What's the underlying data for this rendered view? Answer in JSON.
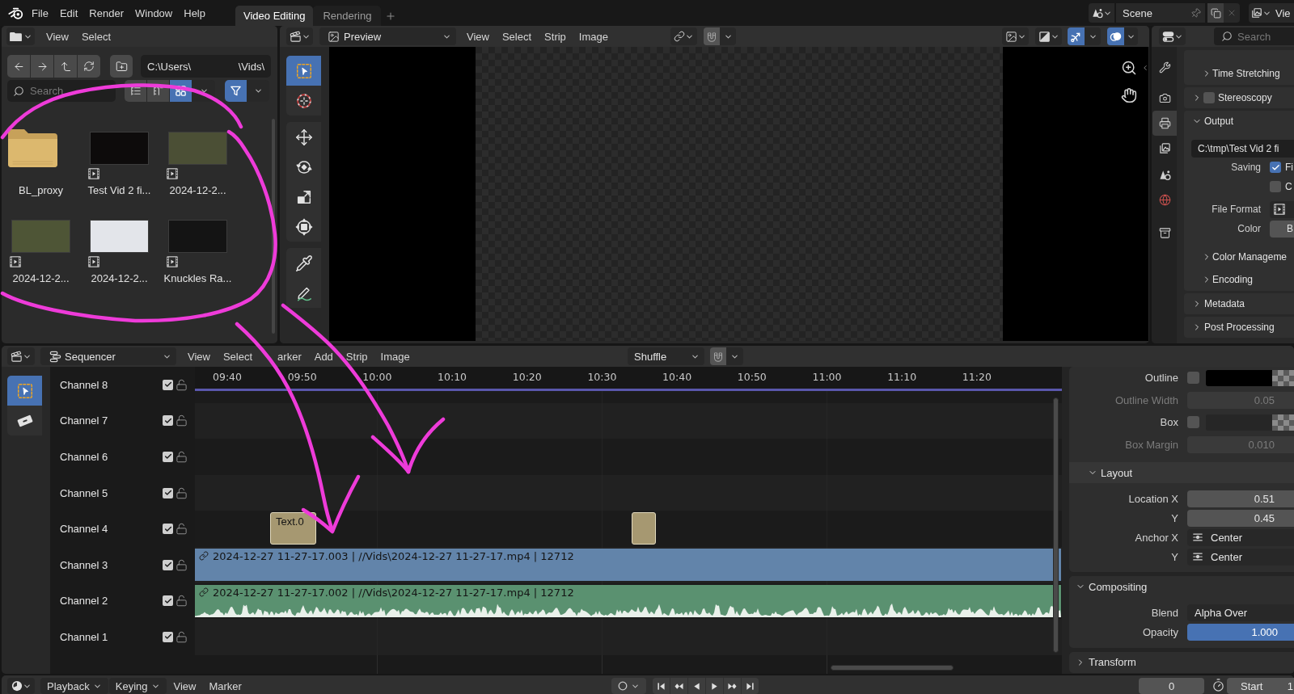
{
  "top_bar": {
    "menus": [
      "File",
      "Edit",
      "Render",
      "Window",
      "Help"
    ],
    "workspaces": [
      {
        "label": "Video Editing",
        "selected": true
      },
      {
        "label": "Rendering",
        "selected": false
      }
    ],
    "scene": "Scene",
    "view_layer": "Vie"
  },
  "file_browser": {
    "menus": [
      "View",
      "Select"
    ],
    "path": [
      "C:\\Users\\",
      "\\Vids\\"
    ],
    "search": {
      "placeholder": "Search"
    },
    "display_modes": [
      {
        "kind": "vertical",
        "selected": false
      },
      {
        "kind": "horizontal",
        "selected": false
      },
      {
        "kind": "thumbnails",
        "selected": true
      }
    ],
    "filter_on": true,
    "files": [
      {
        "kind": "folder",
        "name": "BL_proxy"
      },
      {
        "kind": "movie",
        "name": "Test Vid 2 fi..."
      },
      {
        "kind": "movie",
        "name": "2024-12-2..."
      },
      {
        "kind": "movie",
        "name": "2024-12-2..."
      },
      {
        "kind": "movie",
        "name": "2024-12-2..."
      },
      {
        "kind": "movie",
        "name": "Knuckles Ra..."
      }
    ]
  },
  "preview": {
    "mode": "Preview",
    "menus": [
      "View",
      "Select",
      "Strip",
      "Image"
    ],
    "gizmos_on": true,
    "overlays_on": true,
    "tools": [
      {
        "kind": "select",
        "selected": true
      },
      {
        "kind": "cursor",
        "selected": false
      },
      {
        "kind": "move",
        "selected": false
      },
      {
        "kind": "rotate",
        "selected": false
      },
      {
        "kind": "scale",
        "selected": false
      },
      {
        "kind": "transform",
        "selected": false
      },
      {
        "kind": "sample",
        "selected": false
      },
      {
        "kind": "annotate",
        "selected": false
      }
    ]
  },
  "properties": {
    "search": {
      "placeholder": "Search"
    },
    "tabs": [
      {
        "kind": "tool",
        "selected": false
      },
      {
        "kind": "render",
        "selected": false
      },
      {
        "kind": "output",
        "selected": true
      },
      {
        "kind": "view_layer",
        "selected": false
      },
      {
        "kind": "scene",
        "selected": false
      },
      {
        "kind": "world",
        "selected": false
      },
      {
        "kind": "collection",
        "selected": false
      }
    ],
    "rows": [
      {
        "kind": "subpanel",
        "label": "Time Stretching",
        "expanded": false
      },
      {
        "kind": "panel",
        "label": "Stereoscopy",
        "expanded": false,
        "checked": false
      },
      {
        "kind": "panel",
        "label": "Output",
        "expanded": true
      },
      {
        "kind": "path",
        "value": "C:\\tmp\\Test Vid 2 fi"
      },
      {
        "kind": "checkbox",
        "label": "Saving",
        "checked": true,
        "text": "Fi"
      },
      {
        "kind": "checkbox",
        "checked": false,
        "text": "C"
      },
      {
        "kind": "format",
        "label": "File Format"
      },
      {
        "kind": "field",
        "label": "Color",
        "value": "B"
      },
      {
        "kind": "subpanel",
        "label": "Color Manageme",
        "expanded": false
      },
      {
        "kind": "subpanel",
        "label": "Encoding",
        "expanded": false
      },
      {
        "kind": "panel",
        "label": "Metadata",
        "expanded": false
      },
      {
        "kind": "panel",
        "label": "Post Processing",
        "expanded": false
      }
    ]
  },
  "sequencer": {
    "mode": "Sequencer",
    "menus": [
      "View",
      "Select",
      "arker",
      "Add",
      "Strip",
      "Image"
    ],
    "overlap_mode": "Shuffle",
    "tools": [
      {
        "kind": "select",
        "selected": true
      },
      {
        "kind": "blade",
        "selected": false
      }
    ],
    "ruler": [
      "09:40",
      "09:50",
      "10:00",
      "10:10",
      "10:20",
      "10:30",
      "10:40",
      "10:50",
      "11:00",
      "11:10",
      "11:20"
    ],
    "channels": [
      {
        "name": "Channel 8",
        "visible": true,
        "locked": false
      },
      {
        "name": "Channel 7",
        "visible": true,
        "locked": false
      },
      {
        "name": "Channel 6",
        "visible": true,
        "locked": false
      },
      {
        "name": "Channel 5",
        "visible": true,
        "locked": false
      },
      {
        "name": "Channel 4",
        "visible": true,
        "locked": false,
        "strips": [
          {
            "kind": "text",
            "label": "Text.0"
          },
          {
            "kind": "text"
          }
        ]
      },
      {
        "name": "Channel 3",
        "visible": true,
        "locked": false,
        "strips": [
          {
            "kind": "movie",
            "linked": true,
            "label": "2024-12-27 11-27-17.003 | //Vids\\2024-12-27 11-27-17.mp4 | 12712"
          }
        ]
      },
      {
        "name": "Channel 2",
        "visible": true,
        "locked": false,
        "strips": [
          {
            "kind": "sound",
            "linked": true,
            "label": "2024-12-27 11-27-17.002 | //Vids\\2024-12-27 11-27-17.mp4 | 12712"
          }
        ]
      },
      {
        "name": "Channel 1",
        "visible": true,
        "locked": false
      }
    ]
  },
  "sidebar": {
    "rows": [
      {
        "kind": "color",
        "label": "Outline",
        "checked": false,
        "color": "#000000"
      },
      {
        "kind": "number",
        "label": "Outline Width",
        "value": "0.05",
        "disabled": true
      },
      {
        "kind": "color",
        "label": "Box",
        "checked": false,
        "color": "#262626"
      },
      {
        "kind": "number",
        "label": "Box Margin",
        "value": "0.010",
        "disabled": true
      },
      {
        "kind": "subpanel",
        "label": "Layout",
        "expanded": true
      },
      {
        "kind": "number",
        "label": "Location X",
        "value": "0.51",
        "disabled": false
      },
      {
        "kind": "number",
        "label": "Y",
        "value": "0.45",
        "disabled": false
      },
      {
        "kind": "enum",
        "label": "Anchor X",
        "value": "Center"
      },
      {
        "kind": "enum",
        "label": "Y",
        "value": "Center"
      },
      {
        "kind": "panel",
        "label": "Compositing",
        "expanded": true
      },
      {
        "kind": "dropdown",
        "label": "Blend",
        "value": "Alpha Over"
      },
      {
        "kind": "slider",
        "label": "Opacity",
        "value": "1.000",
        "level": 1
      },
      {
        "kind": "panel",
        "label": "Transform",
        "expanded": false
      }
    ]
  },
  "timeline": {
    "menus": [
      {
        "label": "Playback",
        "dropdown": true
      },
      {
        "label": "Keying",
        "dropdown": true
      },
      {
        "label": "View",
        "dropdown": false
      },
      {
        "label": "Marker",
        "dropdown": false
      }
    ],
    "auto_keying": false,
    "current_frame": "0",
    "start": {
      "label": "Start",
      "value": "1"
    }
  }
}
